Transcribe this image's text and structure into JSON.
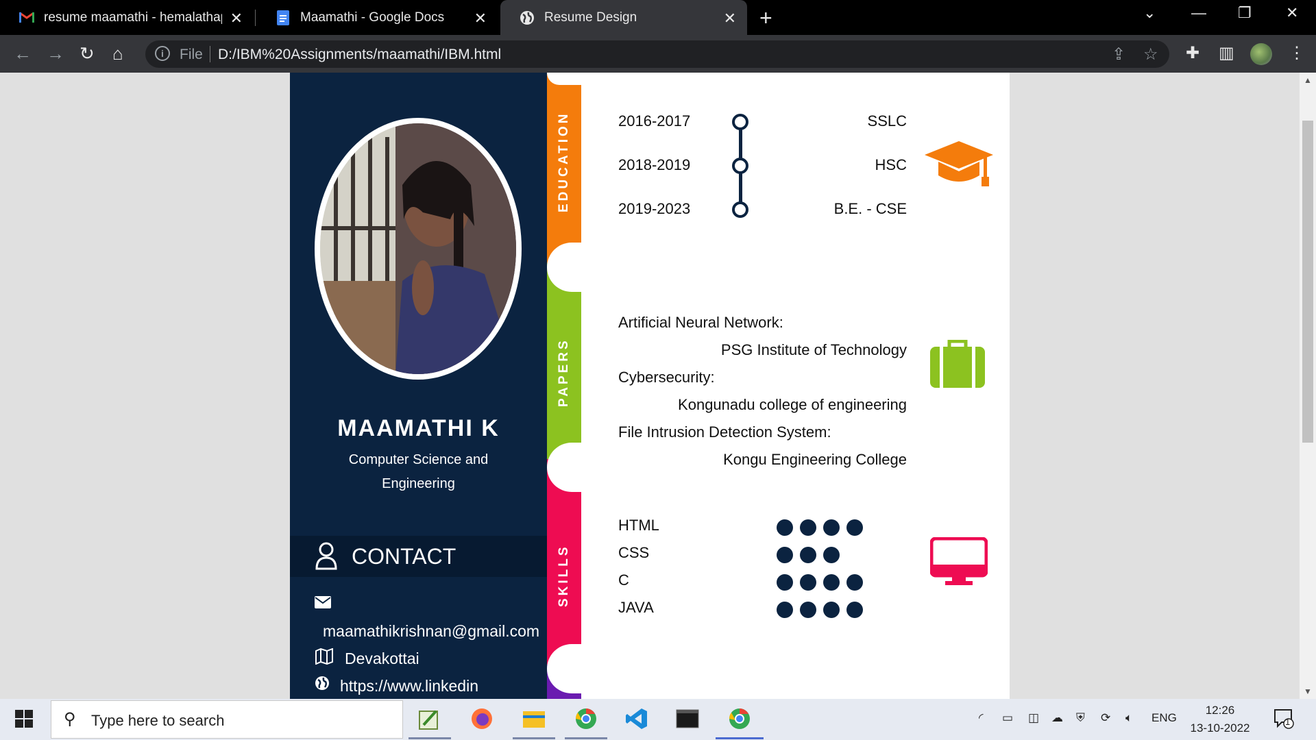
{
  "tabs": [
    {
      "title": "resume maamathi - hemalathap...",
      "favicon": "gmail-icon"
    },
    {
      "title": "Maamathi - Google Docs",
      "favicon": "google-docs-icon"
    },
    {
      "title": "Resume Design",
      "favicon": "globe-icon"
    }
  ],
  "address": {
    "scheme_label": "File",
    "url": "D:/IBM%20Assignments/maamathi/IBM.html"
  },
  "resume": {
    "name": "MAAMATHI K",
    "role": "Computer Science and Engineering",
    "contact_heading": "CONTACT",
    "email": "maamathikrishnan@gmail.com",
    "location": "Devakottai",
    "linkedin": "https://www.linkedin",
    "sections": {
      "education": "EDUCATION",
      "papers": "PAPERS",
      "skills": "SKILLS"
    },
    "education": [
      {
        "years": "2016-2017",
        "qualification": "SSLC"
      },
      {
        "years": "2018-2019",
        "qualification": "HSC"
      },
      {
        "years": "2019-2023",
        "qualification": "B.E. - CSE"
      }
    ],
    "papers": [
      {
        "title": "Artificial Neural Network:",
        "venue": "PSG Institute of Technology"
      },
      {
        "title": "Cybersecurity:",
        "venue": "Kongunadu college of engineering"
      },
      {
        "title": "File Intrusion Detection System:",
        "venue": "Kongu Engineering College"
      }
    ],
    "skills": [
      {
        "name": "HTML",
        "level": 4
      },
      {
        "name": "CSS",
        "level": 3
      },
      {
        "name": "C",
        "level": 4
      },
      {
        "name": "JAVA",
        "level": 4
      }
    ],
    "colors": {
      "navy": "#0b2340",
      "education": "#f47c0c",
      "papers": "#8cc220",
      "skills": "#ee0c52",
      "extra": "#6a1bb0"
    }
  },
  "taskbar": {
    "search_placeholder": "Type here to search",
    "language": "ENG",
    "time": "12:26",
    "date": "13-10-2022",
    "notification_count": "1"
  }
}
